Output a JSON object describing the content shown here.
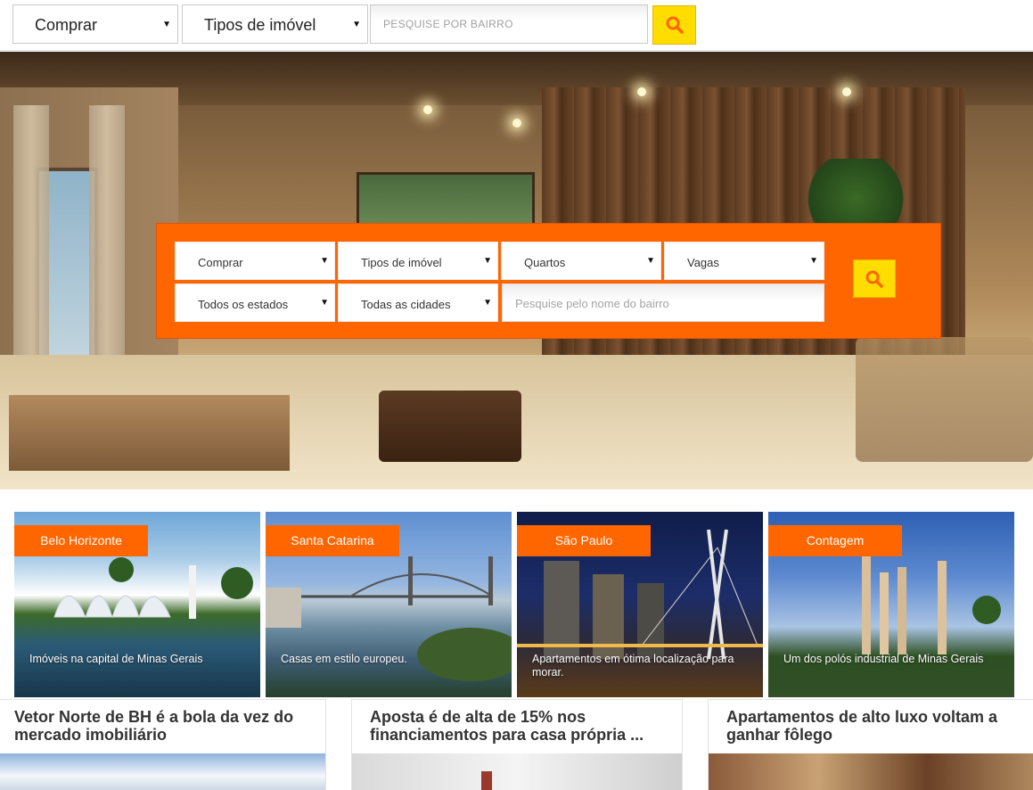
{
  "topbar": {
    "mode_select": "Comprar",
    "type_select": "Tipos de imóvel",
    "search_placeholder": "PESQUISE POR BAIRRO"
  },
  "search_panel": {
    "mode": "Comprar",
    "type": "Tipos de imóvel",
    "rooms": "Quartos",
    "parking": "Vagas",
    "state": "Todos os estados",
    "city": "Todas as cidades",
    "neighborhood_placeholder": "Pesquise pelo nome do bairro"
  },
  "colors": {
    "accent": "#ff6600",
    "search_button": "#ffdd00"
  },
  "icons": {
    "dropdown": "chevron-down-icon",
    "search": "search-icon"
  },
  "cities": [
    {
      "name": "Belo Horizonte",
      "caption": "Imóveis na capital de Minas Gerais"
    },
    {
      "name": "Santa Catarina",
      "caption": "Casas em estilo europeu."
    },
    {
      "name": "São Paulo",
      "caption": "Apartamentos em ótima localização para morar."
    },
    {
      "name": "Contagem",
      "caption": "Um dos polós industrial de Minas Gerais"
    }
  ],
  "news": [
    {
      "title": "Vetor Norte de BH é a bola da vez do mercado imobiliário"
    },
    {
      "title": "Aposta é de alta de 15% nos financiamentos para casa própria ..."
    },
    {
      "title": "Apartamentos de alto luxo voltam a ganhar fôlego"
    }
  ]
}
